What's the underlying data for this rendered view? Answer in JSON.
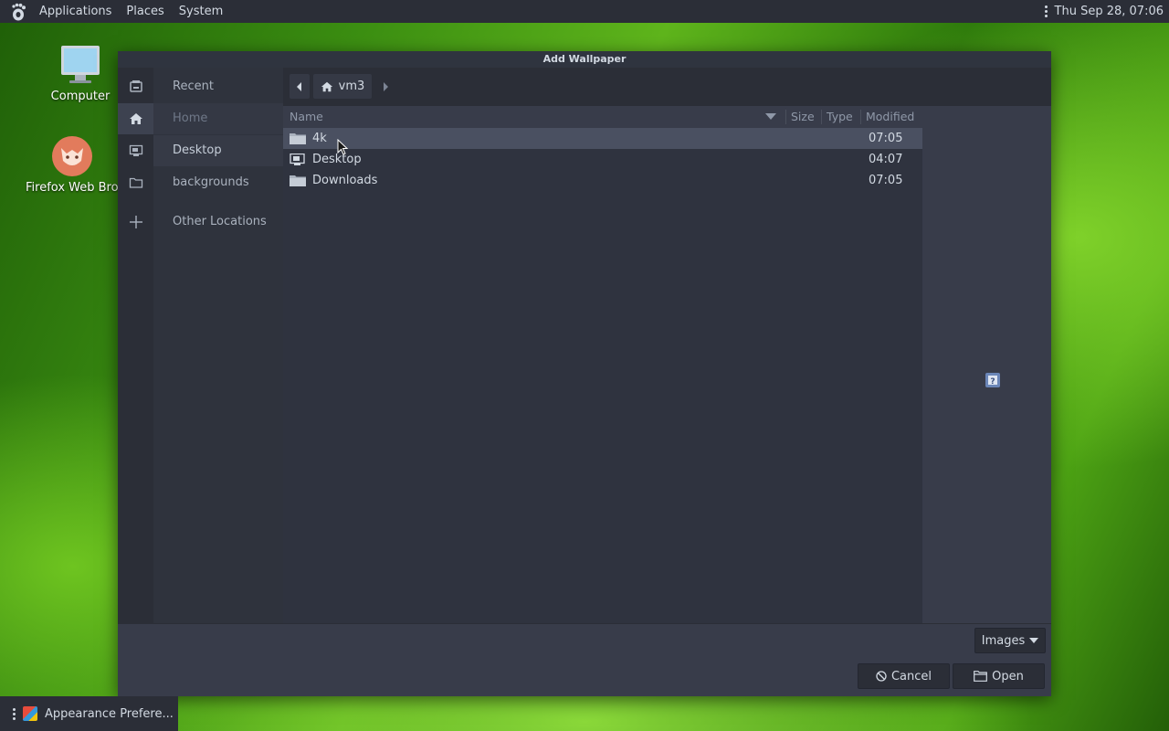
{
  "top_panel": {
    "menus": [
      "Applications",
      "Places",
      "System"
    ],
    "clock": "Thu Sep 28, 07:06"
  },
  "desktop": {
    "icons": [
      {
        "label": "Computer",
        "icon": "computer-icon"
      },
      {
        "label": "Firefox Web Brov",
        "icon": "firefox-icon"
      }
    ]
  },
  "dialog": {
    "title": "Add Wallpaper",
    "sidebar": [
      {
        "label": "Recent",
        "icon": "recent-icon"
      },
      {
        "label": "Home",
        "icon": "home-icon"
      },
      {
        "label": "Desktop",
        "icon": "desktop-icon"
      },
      {
        "label": "backgrounds",
        "icon": "folder-icon"
      },
      {
        "label": "Other Locations",
        "icon": "plus-icon"
      }
    ],
    "pathbar": {
      "current": "vm3"
    },
    "columns": {
      "name": "Name",
      "size": "Size",
      "type": "Type",
      "modified": "Modified"
    },
    "files": [
      {
        "name": "4k",
        "modified": "07:05",
        "icon": "folder-icon"
      },
      {
        "name": "Desktop",
        "modified": "04:07",
        "icon": "desktop-folder-icon"
      },
      {
        "name": "Downloads",
        "modified": "07:05",
        "icon": "folder-icon"
      }
    ],
    "filter": "Images",
    "cancel": "Cancel",
    "open": "Open"
  },
  "taskbar": {
    "task": "Appearance Prefere..."
  },
  "colors": {
    "panel": "#2b2e37",
    "dialog_bg": "#383c4a",
    "selected_row": "#4a5061",
    "text": "#d3dae3"
  }
}
